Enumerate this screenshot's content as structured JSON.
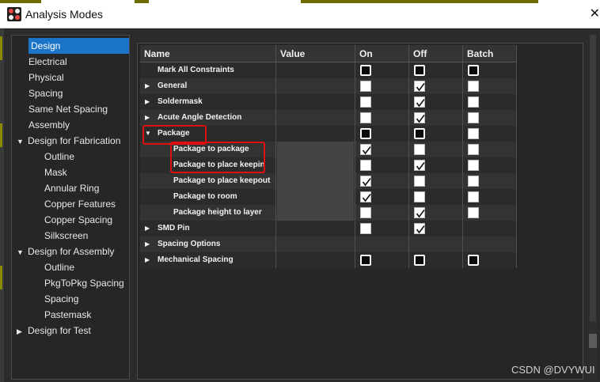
{
  "window": {
    "title": "Analysis Modes",
    "close_glyph": "✕"
  },
  "sidebar": {
    "items": [
      {
        "label": "Design",
        "selected": true,
        "expander": ""
      },
      {
        "label": "Electrical",
        "expander": ""
      },
      {
        "label": "Physical",
        "expander": ""
      },
      {
        "label": "Spacing",
        "expander": ""
      },
      {
        "label": "Same Net Spacing",
        "expander": ""
      },
      {
        "label": "Assembly",
        "expander": ""
      },
      {
        "label": "Design for Fabrication",
        "expander": "▼"
      },
      {
        "label": "Outline",
        "expander": ""
      },
      {
        "label": "Mask",
        "expander": ""
      },
      {
        "label": "Annular Ring",
        "expander": ""
      },
      {
        "label": "Copper Features",
        "expander": ""
      },
      {
        "label": "Copper Spacing",
        "expander": ""
      },
      {
        "label": "Silkscreen",
        "expander": ""
      },
      {
        "label": "Design for Assembly",
        "expander": "▼"
      },
      {
        "label": "Outline",
        "expander": ""
      },
      {
        "label": "PkgToPkg Spacing",
        "expander": ""
      },
      {
        "label": "Spacing",
        "expander": ""
      },
      {
        "label": "Pastemask",
        "expander": ""
      },
      {
        "label": "Design for Test",
        "expander": "▶"
      }
    ]
  },
  "grid": {
    "headers": {
      "name": "Name",
      "value": "Value",
      "on": "On",
      "off": "Off",
      "batch": "Batch"
    },
    "rows": [
      {
        "name": "Mark All Constraints",
        "expander": "",
        "on": "dark",
        "off": "dark",
        "batch": "dark"
      },
      {
        "name": "General",
        "expander": "▶",
        "on": "empty",
        "off": "checked",
        "batch": "empty"
      },
      {
        "name": "Soldermask",
        "expander": "▶",
        "on": "empty",
        "off": "checked",
        "batch": "empty"
      },
      {
        "name": "Acute Angle Detection",
        "expander": "▶",
        "on": "empty",
        "off": "checked",
        "batch": "empty"
      },
      {
        "name": "Package",
        "expander": "▼",
        "on": "dark",
        "off": "dark",
        "batch": "empty"
      },
      {
        "name": "Package to package",
        "expander": "",
        "on": "checked",
        "off": "empty",
        "batch": "empty"
      },
      {
        "name": "Package to place keepin",
        "expander": "",
        "on": "empty",
        "off": "checked",
        "batch": "empty"
      },
      {
        "name": "Package to place keepout",
        "expander": "",
        "on": "checked",
        "off": "empty",
        "batch": "empty"
      },
      {
        "name": "Package to room",
        "expander": "",
        "on": "checked",
        "off": "empty",
        "batch": "empty"
      },
      {
        "name": "Package height to layer",
        "expander": "",
        "on": "empty",
        "off": "checked",
        "batch": "empty"
      },
      {
        "name": "SMD Pin",
        "expander": "▶",
        "on": "empty",
        "off": "checked",
        "batch": "none"
      },
      {
        "name": "Spacing Options",
        "expander": "▶",
        "on": "none",
        "off": "none",
        "batch": "none"
      },
      {
        "name": "Mechanical Spacing",
        "expander": "▶",
        "on": "dark",
        "off": "dark",
        "batch": "dark"
      }
    ]
  },
  "watermark": "CSDN @DVYWUI",
  "colors": {
    "selection": "#1c74c9",
    "highlight_box": "#e01010",
    "background": "#2b2b2b"
  }
}
